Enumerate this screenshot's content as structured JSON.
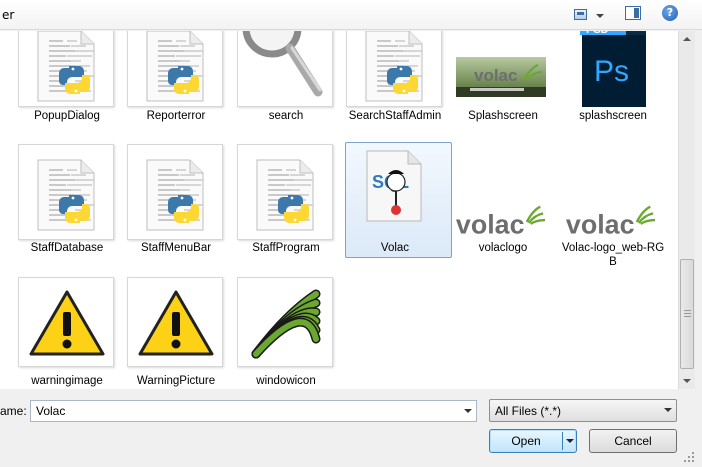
{
  "window": {
    "title_fragment": "er"
  },
  "files": [
    {
      "name": "PopupDialog",
      "icon": "python-file-icon"
    },
    {
      "name": "Reporterror",
      "icon": "python-file-icon"
    },
    {
      "name": "search",
      "icon": "magnifier-image-icon"
    },
    {
      "name": "SearchStaffAdmin",
      "icon": "python-file-icon"
    },
    {
      "name": "Splashscreen",
      "icon": "volac-splash-image-icon"
    },
    {
      "name": "splashscreen",
      "icon": "photoshop-file-icon"
    },
    {
      "name": "StaffDatabase",
      "icon": "python-file-icon"
    },
    {
      "name": "StaffMenuBar",
      "icon": "python-file-icon"
    },
    {
      "name": "StaffProgram",
      "icon": "python-file-icon"
    },
    {
      "name": "Volac",
      "icon": "sql-database-file-icon"
    },
    {
      "name": "volaclogo",
      "icon": "volac-logo-image-icon"
    },
    {
      "name": "Volac-logo_web-RGB",
      "icon": "volac-logo-image-icon"
    },
    {
      "name": "warningimage",
      "icon": "warning-image-icon"
    },
    {
      "name": "WarningPicture",
      "icon": "warning-image-icon"
    },
    {
      "name": "windowicon",
      "icon": "leaf-image-icon"
    }
  ],
  "selected_file": "Volac",
  "logo_text": "volac",
  "psd_badge": "PSD",
  "ps_text": "Ps",
  "sql_text": "SQL",
  "file_name_label": "ame:",
  "file_name_value": "Volac",
  "file_type_filter": "All Files (*.*)",
  "buttons": {
    "open": "Open",
    "cancel": "Cancel"
  },
  "colors": {
    "selection_border": "#7da2ce",
    "volac_green": "#6aa830",
    "volac_grey": "#6d6e70",
    "ps_blue": "#31a8ff",
    "ps_dark": "#001d34",
    "warning_yellow": "#fcd116"
  }
}
